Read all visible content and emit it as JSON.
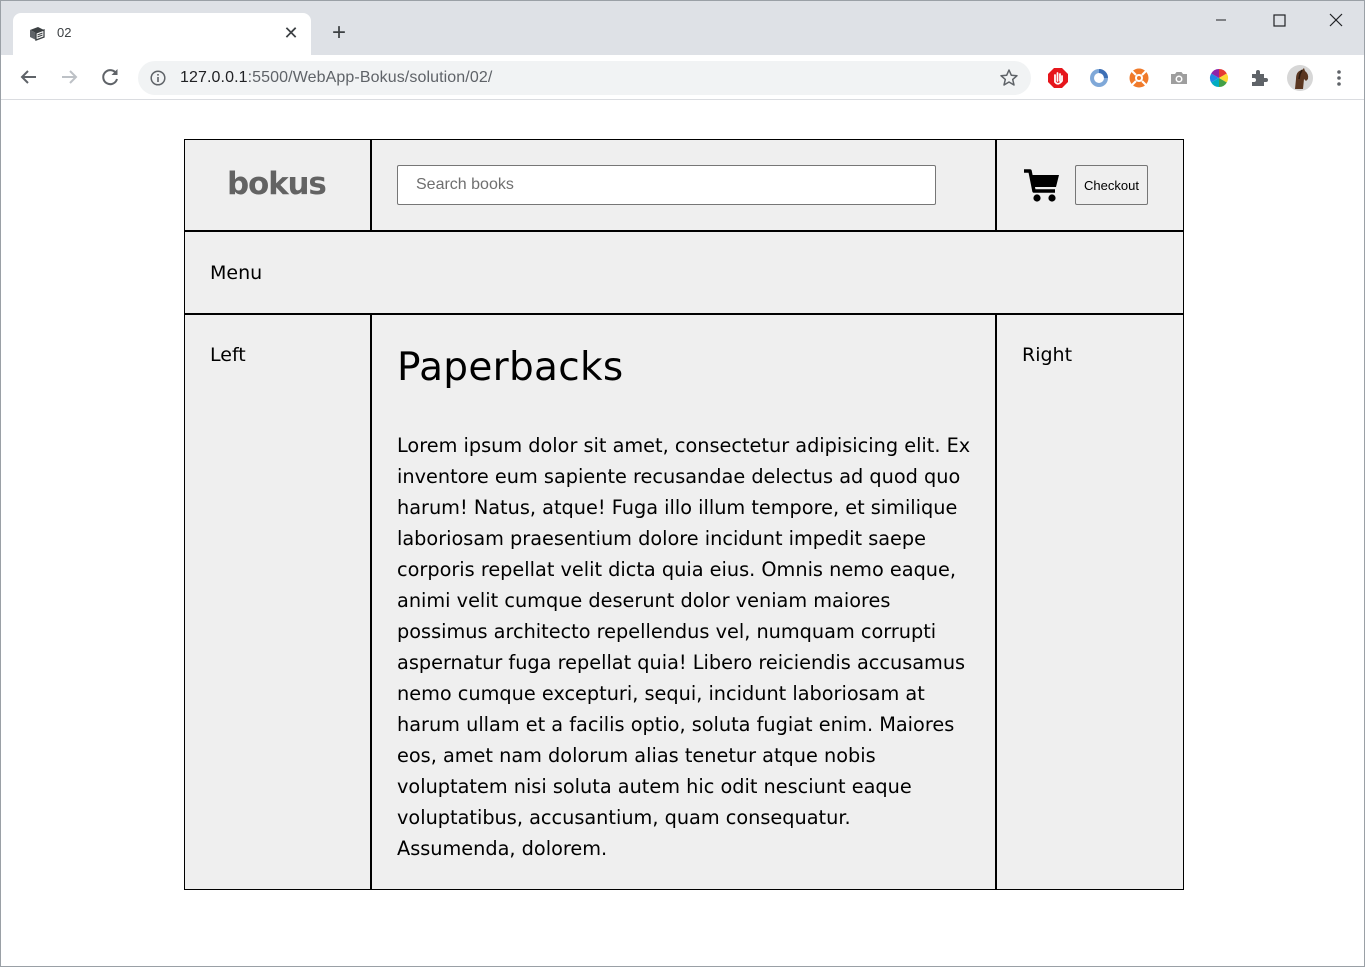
{
  "browser": {
    "tab_title": "02",
    "tab_close": "✕",
    "new_tab": "+",
    "url_host": "127.0.0.1",
    "url_path": ":5500/WebApp-Bokus/solution/02/",
    "icons": [
      "book-icon",
      "back-arrow-icon",
      "forward-arrow-icon",
      "reload-icon",
      "info-icon",
      "star-icon",
      "adblock-icon",
      "extension-blue-icon",
      "extension-orange-icon",
      "camera-icon",
      "color-wheel-icon",
      "puzzle-icon",
      "profile-avatar-icon",
      "kebab-menu-icon"
    ]
  },
  "header": {
    "logo": "bokus",
    "search_placeholder": "Search books",
    "checkout_label": "Checkout"
  },
  "nav": {
    "menu_label": "Menu"
  },
  "left": {
    "label": "Left"
  },
  "right": {
    "label": "Right"
  },
  "main": {
    "title": "Paperbacks",
    "body": "Lorem ipsum dolor sit amet, consectetur adipisicing elit. Ex inventore eum sapiente recusandae delectus ad quod quo harum! Natus, atque! Fuga illo illum tempore, et similique laboriosam praesentium dolore incidunt impedit saepe corporis repellat velit dicta quia eius. Omnis nemo eaque, animi velit cumque deserunt dolor veniam maiores possimus architecto repellendus vel, numquam corrupti aspernatur fuga repellat quia! Libero reiciendis accusamus nemo cumque excepturi, sequi, incidunt laboriosam at harum ullam et a facilis optio, soluta fugiat enim. Maiores eos, amet nam dolorum alias tenetur atque nobis voluptatem nisi soluta autem hic odit nesciunt eaque voluptatibus, accusantium, quam consequatur. Assumenda, dolorem."
  },
  "colors": {
    "tabstrip": "#dee1e6",
    "panel": "#efefef",
    "logo": "#636363"
  }
}
